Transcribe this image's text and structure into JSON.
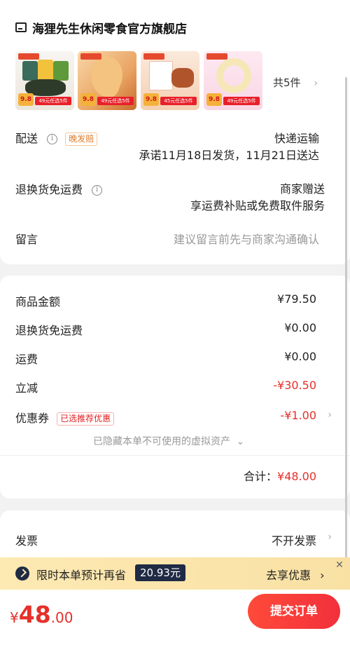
{
  "store": {
    "name": "海狸先生休闲零食官方旗舰店"
  },
  "products": {
    "thumbs": [
      {
        "price_badge": "9.8",
        "promo": "49元任选5件"
      },
      {
        "price_badge": "9.8",
        "promo": "49元任选5件"
      },
      {
        "price_badge": "9.8",
        "promo": "45元任选5件"
      },
      {
        "price_badge": "9.8",
        "promo": "49元任选5件"
      }
    ],
    "count_label": "共5件"
  },
  "delivery": {
    "label": "配送",
    "tag": "晚发赔",
    "method": "快递运输",
    "promise": "承诺11月18日发货，11月21日送达"
  },
  "return_shipping": {
    "label": "退换货免运费",
    "value": "商家赠送",
    "detail": "享运费补贴或免费取件服务"
  },
  "message": {
    "label": "留言",
    "placeholder": "建议留言前先与商家沟通确认"
  },
  "price_detail": {
    "goods_amount_label": "商品金额",
    "goods_amount": "¥79.50",
    "return_fee_label": "退换货免运费",
    "return_fee": "¥0.00",
    "shipping_label": "运费",
    "shipping": "¥0.00",
    "discount_label": "立减",
    "discount": "-¥30.50",
    "coupon_label": "优惠券",
    "coupon_tag": "已选推荐优惠",
    "coupon_value": "-¥1.00",
    "hidden_assets": "已隐藏本单不可使用的虚拟资产",
    "total_label": "合计：",
    "total_value": "¥48.00"
  },
  "invoice": {
    "label": "发票",
    "value": "不开发票"
  },
  "banner": {
    "text": "限时本单预计再省",
    "amount": "20.93元",
    "action": "去享优惠"
  },
  "footer": {
    "currency": "¥",
    "total_int": "48",
    "total_dec": ".00",
    "submit_label": "提交订单"
  },
  "colors": {
    "accent_red": "#e5302b",
    "banner_bg": "#fde9b3",
    "badge_dark": "#1f2a44"
  }
}
